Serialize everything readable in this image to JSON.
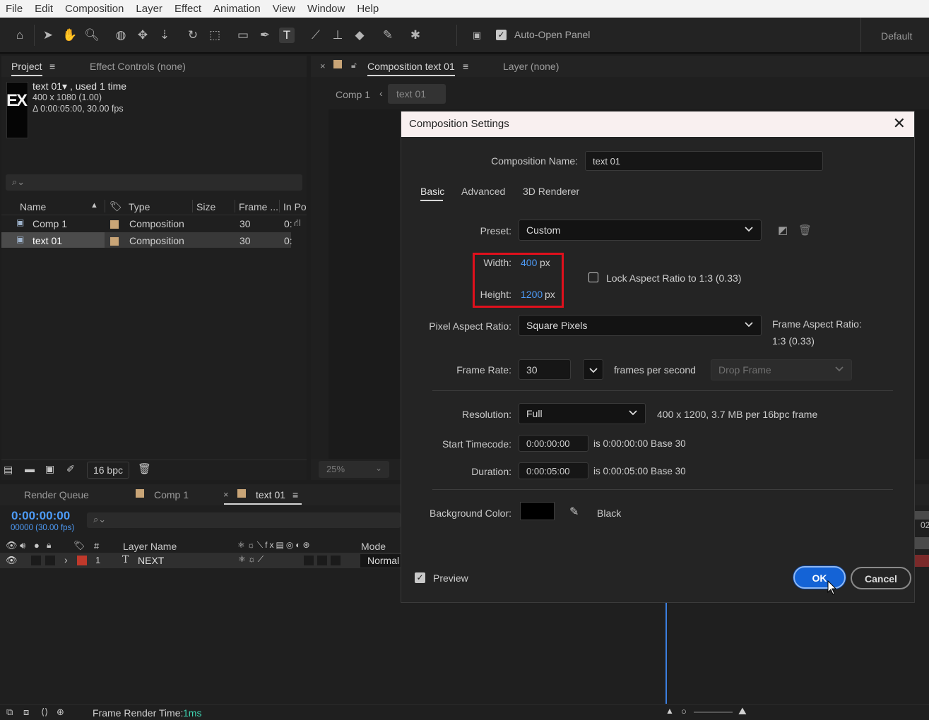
{
  "menubar": {
    "items": [
      "File",
      "Edit",
      "Composition",
      "Layer",
      "Effect",
      "Animation",
      "View",
      "Window",
      "Help"
    ]
  },
  "toolbar": {
    "auto_open_panel": "Auto-Open Panel",
    "workspace": "Default"
  },
  "project_panel": {
    "tab_project": "Project",
    "tab_effect_controls": "Effect Controls (none)",
    "thumb_text": "EX",
    "info_name": "text 01▾ , used 1 time",
    "info_size": "400 x 1080 (1.00)",
    "info_duration": "Δ 0:00:05:00, 30.00 fps",
    "columns": {
      "name": "Name",
      "type": "Type",
      "size": "Size",
      "frame": "Frame ...",
      "in_point": "In Po"
    },
    "rows": [
      {
        "name": "Comp 1",
        "type": "Composition",
        "frame": "30",
        "in": "0:"
      },
      {
        "name": "text 01",
        "type": "Composition",
        "frame": "30",
        "in": "0:"
      }
    ],
    "bpc": "16 bpc"
  },
  "viewer": {
    "tab_comp": "Composition text 01",
    "tab_layer": "Layer (none)",
    "crumb_1": "Comp 1",
    "crumb_2": "text 01",
    "zoom": "25%"
  },
  "timeline": {
    "tab_render_queue": "Render Queue",
    "tab_comp1": "Comp 1",
    "tab_text01": "text 01",
    "timecode": "0:00:00:00",
    "frames": "00000 (30.00 fps)",
    "col_layer_name": "Layer Name",
    "col_mode": "Mode",
    "col_hash": "#",
    "layer_num": "1",
    "layer_name": "NEXT",
    "layer_mode": "Normal",
    "ruler_label": "02",
    "frame_render_label": "Frame Render Time:",
    "frame_render_value": "1ms"
  },
  "dialog": {
    "title": "Composition Settings",
    "comp_name_label": "Composition Name:",
    "comp_name_value": "text 01",
    "tabs": [
      "Basic",
      "Advanced",
      "3D Renderer"
    ],
    "preset_label": "Preset:",
    "preset_value": "Custom",
    "width_label": "Width:",
    "width_value": "400",
    "height_label": "Height:",
    "height_value": "1200",
    "unit_px": "px",
    "lock_aspect": "Lock Aspect Ratio to 1:3 (0.33)",
    "par_label": "Pixel Aspect Ratio:",
    "par_value": "Square Pixels",
    "far_label": "Frame Aspect Ratio:",
    "far_value": "1:3 (0.33)",
    "frame_rate_label": "Frame Rate:",
    "frame_rate_value": "30",
    "fps_text": "frames per second",
    "drop_frame": "Drop Frame",
    "resolution_label": "Resolution:",
    "resolution_value": "Full",
    "resolution_info": "400 x 1200, 3.7 MB per 16bpc frame",
    "start_tc_label": "Start Timecode:",
    "start_tc_value": "0:00:00:00",
    "start_tc_info": "is 0:00:00:00  Base 30",
    "duration_label": "Duration:",
    "duration_value": "0:00:05:00",
    "duration_info": "is 0:00:05:00  Base 30",
    "bg_label": "Background Color:",
    "bg_name": "Black",
    "preview": "Preview",
    "ok": "OK",
    "cancel": "Cancel",
    "colors": {
      "highlight_box": "#e0101c",
      "ok_button": "#1463d6",
      "value_blue": "#4d9bf7"
    }
  }
}
